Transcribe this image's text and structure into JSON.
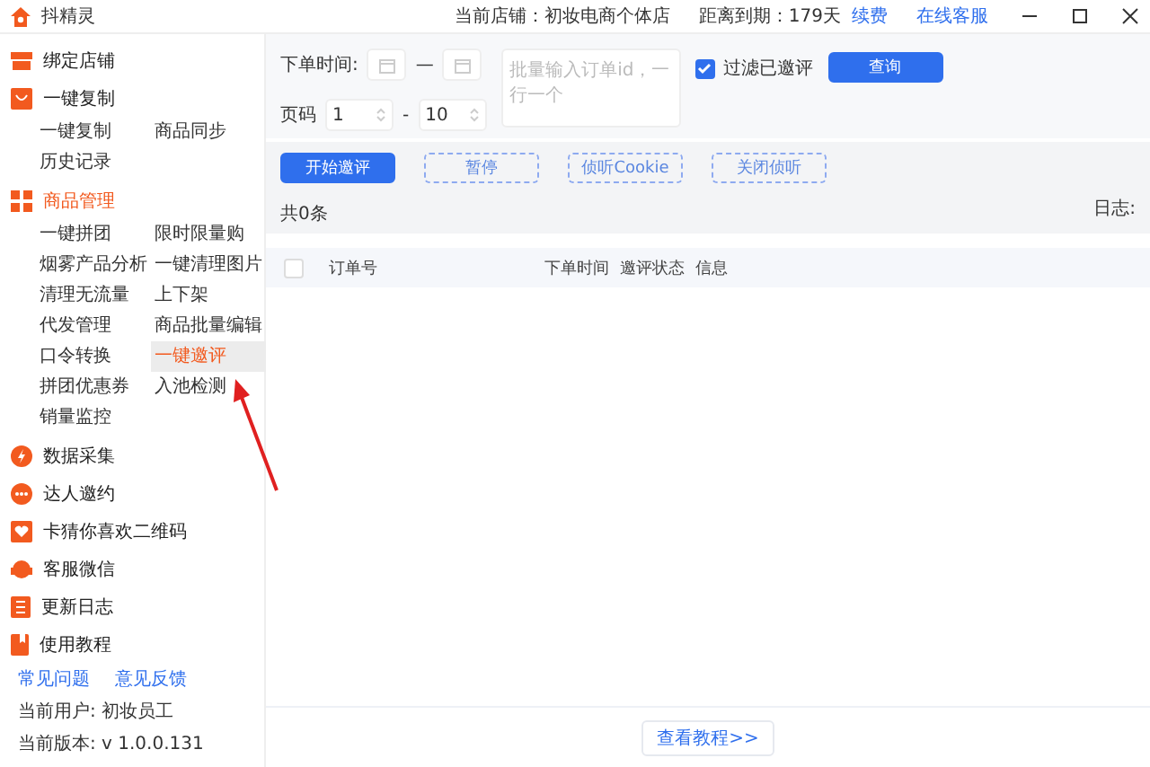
{
  "window": {
    "title": "抖精灵",
    "shop": "当前店铺：初妆电商个体店",
    "expiry": "距离到期：179天",
    "renew": "续费",
    "support": "在线客服"
  },
  "sidebar": {
    "items": [
      {
        "label": "绑定店铺",
        "selected": false
      },
      {
        "label": "一键复制",
        "selected": false,
        "children": [
          {
            "label": "一键复制",
            "selected": false
          },
          {
            "label": "商品同步",
            "selected": false
          },
          {
            "label": "历史记录",
            "selected": false
          }
        ]
      },
      {
        "label": "商品管理",
        "selected": true,
        "children": [
          {
            "label": "一键拼团",
            "selected": false
          },
          {
            "label": "限时限量购",
            "selected": false
          },
          {
            "label": "烟雾产品分析",
            "selected": false
          },
          {
            "label": "一键清理图片",
            "selected": false
          },
          {
            "label": "清理无流量",
            "selected": false
          },
          {
            "label": "上下架",
            "selected": false
          },
          {
            "label": "代发管理",
            "selected": false
          },
          {
            "label": "商品批量编辑",
            "selected": false
          },
          {
            "label": "口令转换",
            "selected": false
          },
          {
            "label": "一键邀评",
            "selected": true
          },
          {
            "label": "拼团优惠券",
            "selected": false
          },
          {
            "label": "入池检测",
            "selected": false
          },
          {
            "label": "销量监控",
            "selected": false
          }
        ]
      },
      {
        "label": "数据采集",
        "selected": false
      },
      {
        "label": "达人邀约",
        "selected": false
      },
      {
        "label": "卡猜你喜欢二维码",
        "selected": false
      },
      {
        "label": "客服微信",
        "selected": false
      },
      {
        "label": "更新日志",
        "selected": false
      },
      {
        "label": "使用教程",
        "selected": false
      }
    ],
    "links": [
      "常见问题",
      "意见反馈"
    ],
    "user": "当前用户: 初妆员工",
    "version": "当前版本: v 1.0.0.131"
  },
  "form": {
    "date_label": "下单时间:",
    "date_separator": "—",
    "order_ids": {
      "placeholder": "批量输入订单id，一行一个"
    },
    "filter": {
      "label": "过滤已邀评",
      "checked": true
    },
    "query": "查询",
    "page_label": "页码",
    "page_from": "1",
    "page_separator": "-",
    "page_to": "10"
  },
  "actions": [
    {
      "label": "开始邀评",
      "kind": "primary"
    },
    {
      "label": "暂停",
      "kind": "dashed"
    },
    {
      "label": "侦听Cookie",
      "kind": "dashed"
    },
    {
      "label": "关闭侦听",
      "kind": "dashed"
    }
  ],
  "count": "共0条",
  "log_label": "日志:",
  "table": {
    "select_all": {
      "checked": false
    },
    "columns": [
      "订单号",
      "下单时间",
      "邀评状态",
      "信息"
    ]
  },
  "footer": {
    "tutorial": "查看教程>>"
  }
}
